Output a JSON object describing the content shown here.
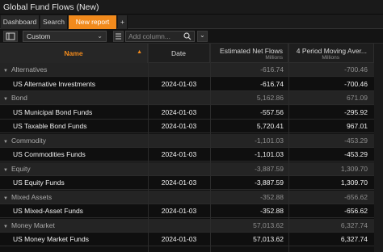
{
  "window": {
    "title": "Global Fund Flows (New)"
  },
  "tabs": [
    {
      "label": "Dashboard"
    },
    {
      "label": "Search"
    },
    {
      "label": "New report"
    },
    {
      "label": "+"
    }
  ],
  "toolbar": {
    "view_select": "Custom",
    "search_placeholder": "Add column..."
  },
  "columns": {
    "name": "Name",
    "date": "Date",
    "flows": "Estimated Net Flows",
    "flows_unit": "Millions",
    "ma": "4 Period Moving Aver...",
    "ma_unit": "Millions"
  },
  "rows": [
    {
      "type": "group",
      "name": "Alternatives",
      "date": "",
      "flows": "-616.74",
      "ma": "-700.46"
    },
    {
      "type": "fund",
      "name": "US Alternative Investments",
      "date": "2024-01-03",
      "flows": "-616.74",
      "ma": "-700.46"
    },
    {
      "type": "group",
      "name": "Bond",
      "date": "",
      "flows": "5,162.86",
      "ma": "671.09"
    },
    {
      "type": "fund",
      "name": "US Municipal Bond Funds",
      "date": "2024-01-03",
      "flows": "-557.56",
      "ma": "-295.92"
    },
    {
      "type": "fund",
      "name": "US Taxable Bond Funds",
      "date": "2024-01-03",
      "flows": "5,720.41",
      "ma": "967.01"
    },
    {
      "type": "group",
      "name": "Commodity",
      "date": "",
      "flows": "-1,101.03",
      "ma": "-453.29"
    },
    {
      "type": "fund",
      "name": "US Commodities Funds",
      "date": "2024-01-03",
      "flows": "-1,101.03",
      "ma": "-453.29"
    },
    {
      "type": "group",
      "name": "Equity",
      "date": "",
      "flows": "-3,887.59",
      "ma": "1,309.70"
    },
    {
      "type": "fund",
      "name": "US Equity Funds",
      "date": "2024-01-03",
      "flows": "-3,887.59",
      "ma": "1,309.70"
    },
    {
      "type": "group",
      "name": "Mixed Assets",
      "date": "",
      "flows": "-352.88",
      "ma": "-656.62"
    },
    {
      "type": "fund",
      "name": "US Mixed-Asset Funds",
      "date": "2024-01-03",
      "flows": "-352.88",
      "ma": "-656.62"
    },
    {
      "type": "group",
      "name": "Money Market",
      "date": "",
      "flows": "57,013.62",
      "ma": "6,327.74"
    },
    {
      "type": "fund",
      "name": "US Money Market Funds",
      "date": "2024-01-03",
      "flows": "57,013.62",
      "ma": "6,327.74"
    }
  ],
  "colors": {
    "accent": "#f28a1c",
    "background": "#111111",
    "group_row": "#242424"
  }
}
